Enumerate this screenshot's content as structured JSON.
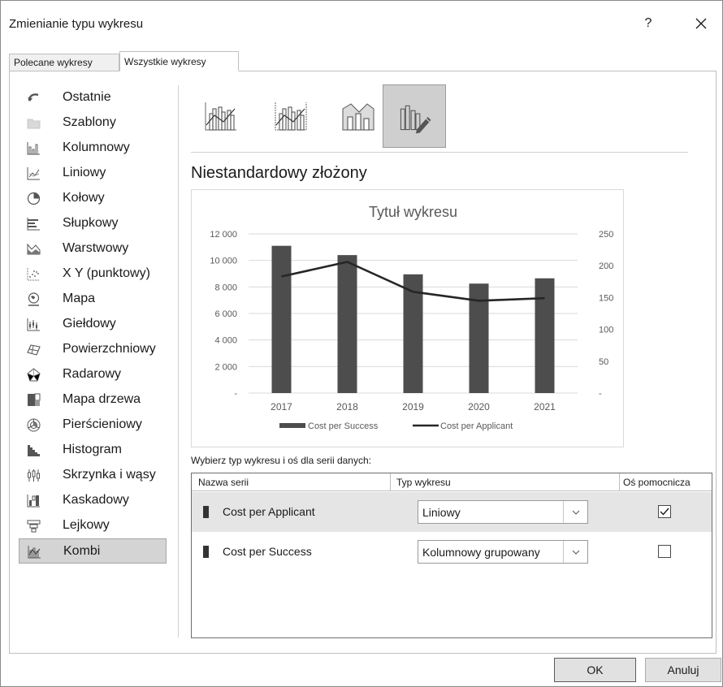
{
  "window": {
    "title": "Zmienianie typu wykresu",
    "help": "?",
    "close": "✕"
  },
  "tabs": {
    "recommended": "Polecane wykresy",
    "all": "Wszystkie wykresy"
  },
  "nav": {
    "items": [
      {
        "label": "Ostatnie",
        "icon": "recent-icon"
      },
      {
        "label": "Szablony",
        "icon": "templates-icon"
      },
      {
        "label": "Kolumnowy",
        "icon": "column-chart-icon"
      },
      {
        "label": "Liniowy",
        "icon": "line-chart-icon"
      },
      {
        "label": "Kołowy",
        "icon": "pie-chart-icon"
      },
      {
        "label": "Słupkowy",
        "icon": "bar-chart-icon"
      },
      {
        "label": "Warstwowy",
        "icon": "area-chart-icon"
      },
      {
        "label": "X Y (punktowy)",
        "icon": "scatter-chart-icon"
      },
      {
        "label": "Mapa",
        "icon": "map-chart-icon"
      },
      {
        "label": "Giełdowy",
        "icon": "stock-chart-icon"
      },
      {
        "label": "Powierzchniowy",
        "icon": "surface-chart-icon"
      },
      {
        "label": "Radarowy",
        "icon": "radar-chart-icon"
      },
      {
        "label": "Mapa drzewa",
        "icon": "treemap-chart-icon"
      },
      {
        "label": "Pierścieniowy",
        "icon": "sunburst-chart-icon"
      },
      {
        "label": "Histogram",
        "icon": "histogram-chart-icon"
      },
      {
        "label": "Skrzynka i wąsy",
        "icon": "box-whisker-chart-icon"
      },
      {
        "label": "Kaskadowy",
        "icon": "waterfall-chart-icon"
      },
      {
        "label": "Lejkowy",
        "icon": "funnel-chart-icon"
      },
      {
        "label": "Kombi",
        "icon": "combo-chart-icon"
      }
    ],
    "selected": "Kombi"
  },
  "subtypes": [
    "clustered-column-line-icon",
    "clustered-column-line-secondary-icon",
    "stacked-area-column-icon",
    "custom-combo-icon"
  ],
  "section_title": "Niestandardowy złożony",
  "chart_data": {
    "type": "bar",
    "title": "Tytuł wykresu",
    "categories": [
      "2017",
      "2018",
      "2019",
      "2020",
      "2021"
    ],
    "series": [
      {
        "name": "Cost per Success",
        "type": "bar",
        "axis": "primary",
        "values": [
          11100,
          10400,
          8950,
          8250,
          8650
        ],
        "color": "#4d4d4d"
      },
      {
        "name": "Cost per Applicant",
        "type": "line",
        "axis": "secondary",
        "values": [
          183,
          206,
          159,
          145,
          149
        ],
        "color": "#262626"
      }
    ],
    "ylim": [
      0,
      12000
    ],
    "yticks": [
      "12 000",
      "10 000",
      "8 000",
      "6 000",
      "4 000",
      "2 000",
      "-"
    ],
    "y2lim": [
      0,
      250
    ],
    "y2ticks": [
      "250",
      "200",
      "150",
      "100",
      "50",
      "-"
    ],
    "grid": true,
    "legend": "bottom"
  },
  "series_caption": "Wybierz typ wykresu i oś dla serii danych:",
  "grid": {
    "headers": {
      "name": "Nazwa serii",
      "type": "Typ wykresu",
      "axis": "Oś pomocnicza"
    },
    "rows": [
      {
        "name": "Cost per Applicant",
        "type": "Liniowy",
        "secondary": true
      },
      {
        "name": "Cost per Success",
        "type": "Kolumnowy grupowany",
        "secondary": false
      }
    ]
  },
  "buttons": {
    "ok": "OK",
    "cancel": "Anuluj"
  }
}
